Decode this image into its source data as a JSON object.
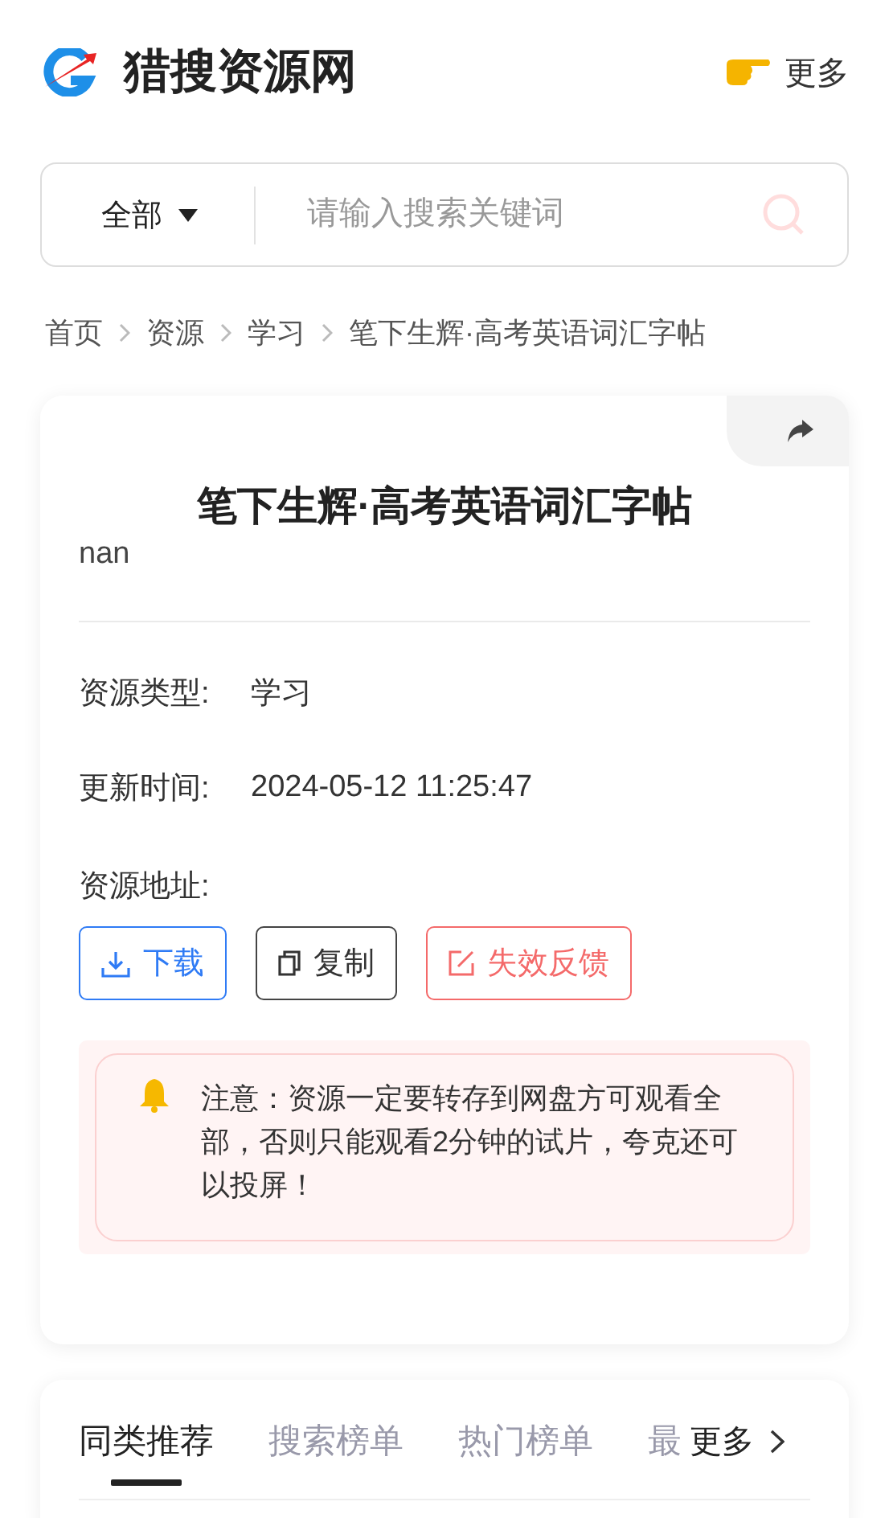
{
  "header": {
    "site_name": "猎搜资源网",
    "more": "更多"
  },
  "search": {
    "category": "全部",
    "placeholder": "请输入搜索关键词"
  },
  "breadcrumb": [
    "首页",
    "资源",
    "学习",
    "笔下生辉·高考英语词汇字帖"
  ],
  "resource": {
    "title": "笔下生辉·高考英语词汇字帖",
    "description": "nan",
    "fields": [
      {
        "label": "资源类型:",
        "value": "学习"
      },
      {
        "label": "更新时间:",
        "value": "2024-05-12 11:25:47"
      }
    ],
    "address_label": "资源地址:",
    "buttons": [
      {
        "kind": "download",
        "label": "下载"
      },
      {
        "kind": "copy",
        "label": "复制"
      },
      {
        "kind": "report",
        "label": "失效反馈"
      }
    ],
    "notice": "注意：资源一定要转存到网盘方可观看全部，否则只能观看2分钟的试片，夸克还可以投屏！"
  },
  "related": {
    "tabs": [
      {
        "label": "同类推荐",
        "selected": true
      },
      {
        "label": "搜索榜单",
        "selected": false
      },
      {
        "label": "热门榜单",
        "selected": false
      },
      {
        "label": "最",
        "selected": false
      }
    ],
    "more": "更多"
  }
}
